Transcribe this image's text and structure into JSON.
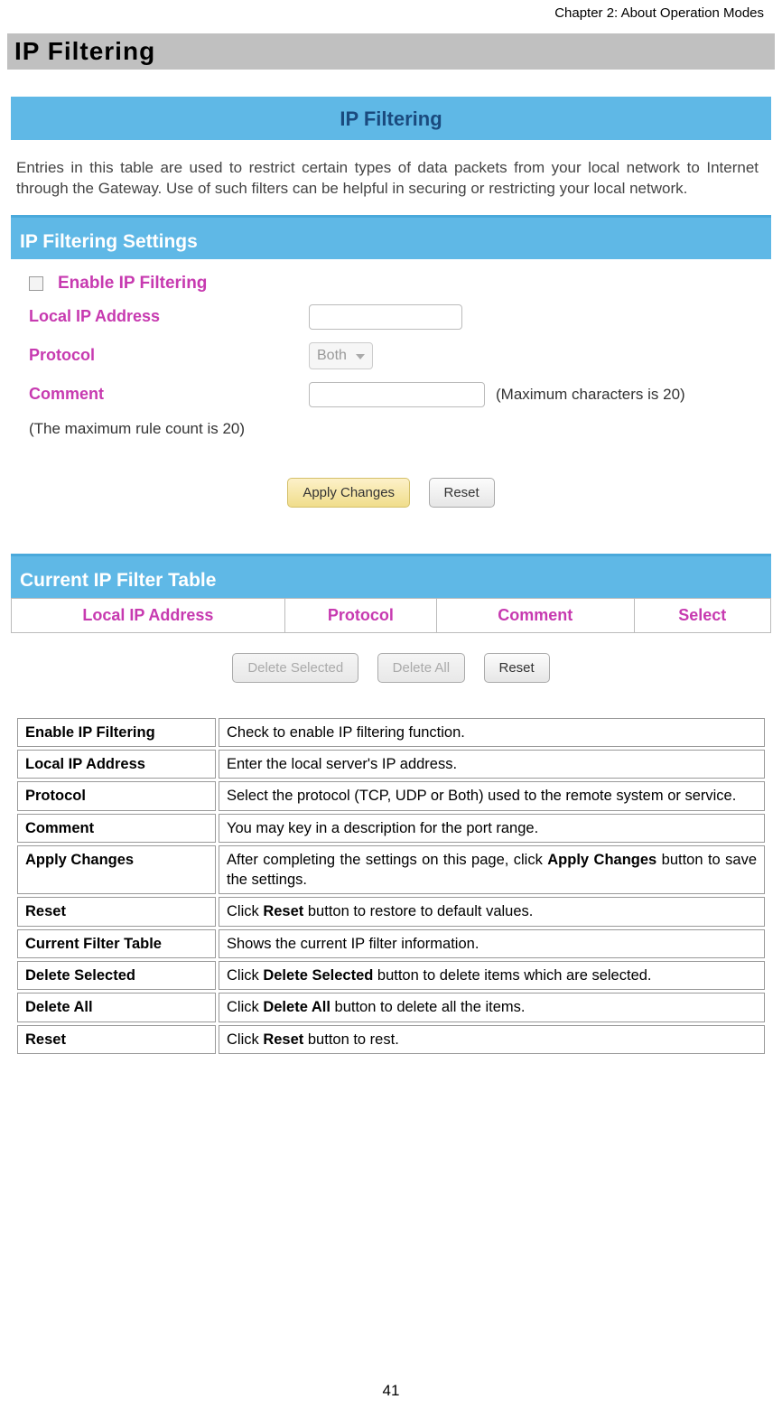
{
  "chapter": "Chapter 2: About Operation Modes",
  "title": "IP Filtering",
  "router": {
    "header": "IP Filtering",
    "desc": "Entries in this table are used to restrict certain types of data packets from your local network to Internet through the Gateway. Use of such filters can be helpful in securing or restricting your local network.",
    "settings_title": "IP Filtering Settings",
    "enable_label": "Enable IP Filtering",
    "local_ip_label": "Local IP Address",
    "protocol_label": "Protocol",
    "protocol_value": "Both",
    "comment_label": "Comment",
    "comment_hint": "(Maximum characters is 20)",
    "rule_note": "(The maximum rule count is 20)",
    "apply_btn": "Apply Changes",
    "reset_btn": "Reset",
    "table_title": "Current IP Filter Table",
    "th1": "Local IP Address",
    "th2": "Protocol",
    "th3": "Comment",
    "th4": "Select",
    "del_sel_btn": "Delete Selected",
    "del_all_btn": "Delete All",
    "reset2_btn": "Reset"
  },
  "rows": [
    {
      "k": "Enable IP Filtering",
      "v": "Check to enable IP filtering function."
    },
    {
      "k": "Local IP Address",
      "v": "Enter the local server's IP address."
    },
    {
      "k": "Protocol",
      "v": "Select the protocol (TCP, UDP or Both) used to the remote system or service."
    },
    {
      "k": "Comment",
      "v": "You may key in a description for the port range."
    },
    {
      "k": "Apply Changes",
      "v_pre": "After completing the settings on this page, click ",
      "v_bold": "Apply Changes",
      "v_post": " button to save the settings."
    },
    {
      "k": "Reset",
      "v_pre": "Click ",
      "v_bold": "Reset",
      "v_post": " button to restore to default values."
    },
    {
      "k": "Current Filter Table",
      "v": "Shows the current IP filter information."
    },
    {
      "k": "Delete Selected",
      "v_pre": "Click ",
      "v_bold": "Delete Selected",
      "v_post": " button to delete items which are selected."
    },
    {
      "k": "Delete All",
      "v_pre": "Click ",
      "v_bold": "Delete All",
      "v_post": " button to delete all the items."
    },
    {
      "k": "Reset",
      "v_pre": "Click ",
      "v_bold": "Reset",
      "v_post": " button to rest."
    }
  ],
  "page_num": "41"
}
